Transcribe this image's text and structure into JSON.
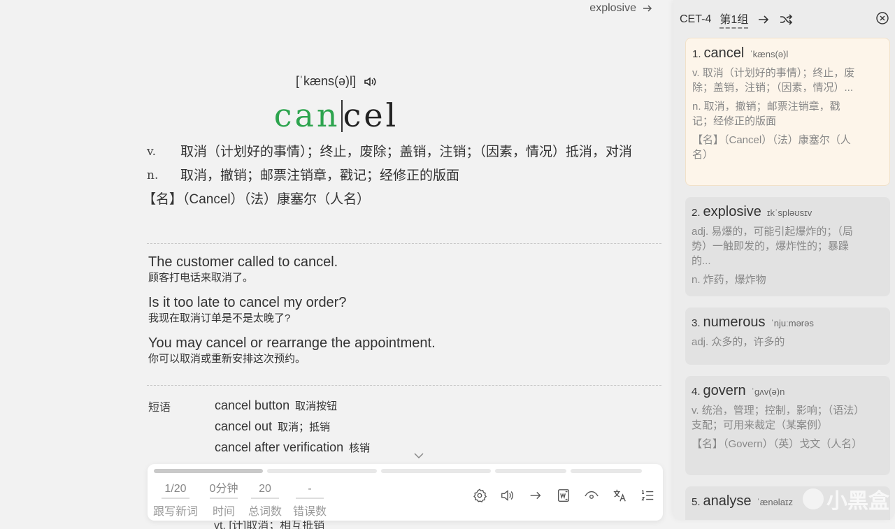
{
  "header": {
    "next_word": "explosive"
  },
  "word": {
    "phonetic": "[ˈkæns(ə)l]",
    "typed": "can",
    "untyped": "cel"
  },
  "definitions": [
    {
      "pos": "v.",
      "text": "取消（计划好的事情）；终止，废除；盖销，注销；（因素，情况）抵消，对消"
    },
    {
      "pos": "n.",
      "text": "取消，撤销；邮票注销章，戳记；经修正的版面"
    }
  ],
  "name_def": "【名】（Cancel）（法）康塞尔（人名）",
  "examples": [
    {
      "en": "The customer called to cancel.",
      "zh": "顾客打电话来取消了。"
    },
    {
      "en": "Is it too late to cancel my order?",
      "zh": "我现在取消订单是不是太晚了?"
    },
    {
      "en": "You may cancel or rearrange the appointment.",
      "zh": "你可以取消或重新安排这次预约。"
    }
  ],
  "phrases": {
    "label": "短语",
    "items": [
      {
        "en": "cancel button",
        "zh": "取消按钮"
      },
      {
        "en": "cancel out",
        "zh": "取消；抵销"
      },
      {
        "en": "cancel after verification",
        "zh": "核销"
      }
    ]
  },
  "behind_text": "vt.    [计]取消；相互抵销",
  "stats": [
    {
      "value": "1/20",
      "label": "跟写新词"
    },
    {
      "value": "0分钟",
      "label": "时间"
    },
    {
      "value": "20",
      "label": "总词数"
    },
    {
      "value": "-",
      "label": "错误数"
    }
  ],
  "progress": {
    "fraction": 0.05
  },
  "toolbar_icons": [
    "gear-icon",
    "speaker-icon",
    "arrow-right-icon",
    "word-doc-icon",
    "eye-icon",
    "translate-icon",
    "list-icon"
  ],
  "sidebar": {
    "dict": "CET-4",
    "group": "第1组",
    "cards": [
      {
        "num": "1.",
        "word": "cancel",
        "phonetic": "ˈkæns(ə)l",
        "defs": [
          "v. 取消（计划好的事情）；终止，废除；盖销，注销；（因素，情况）...",
          "n. 取消，撤销；邮票注销章，戳记；经修正的版面",
          "【名】（Cancel）（法）康塞尔（人名）"
        ]
      },
      {
        "num": "2.",
        "word": "explosive",
        "phonetic": "ɪkˈspləʊsɪv",
        "defs": [
          "adj. 易爆的，可能引起爆炸的；（局势）一触即发的，爆炸性的；暴躁的...",
          "n. 炸药，爆炸物"
        ]
      },
      {
        "num": "3.",
        "word": "numerous",
        "phonetic": "ˈnjuːmərəs",
        "defs": [
          "adj. 众多的，许多的"
        ]
      },
      {
        "num": "4.",
        "word": "govern",
        "phonetic": "ˈɡʌv(ə)n",
        "defs": [
          "v. 统治，管理；控制，影响；（语法）支配；可用来裁定（某案例）",
          "【名】（Govern）（英）戈文（人名）"
        ]
      },
      {
        "num": "5.",
        "word": "analyse",
        "phonetic": "ˈænəlaɪz",
        "defs": []
      }
    ]
  },
  "watermark": "小黑盒"
}
